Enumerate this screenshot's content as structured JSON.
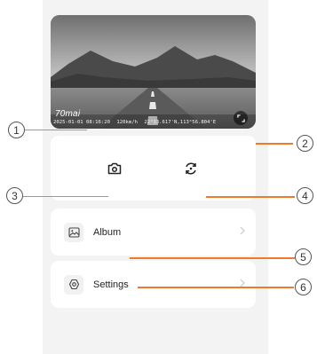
{
  "preview": {
    "brand": "70mai",
    "datetime": "2025-01-01 08:16:20",
    "speed": "120km/h",
    "coordinates": "22°33.617'N,113°56.804'E",
    "fullscreen_icon": "fullscreen-icon"
  },
  "controls": {
    "snapshot_icon": "camera-icon",
    "switch_icon": "switch-camera-icon"
  },
  "menu": {
    "album_label": "Album",
    "settings_label": "Settings"
  },
  "markers": [
    "1",
    "2",
    "3",
    "4",
    "5",
    "6"
  ],
  "colors": {
    "leader": "#ee7a2a",
    "background": "#f3f3f3",
    "card": "#ffffff"
  }
}
